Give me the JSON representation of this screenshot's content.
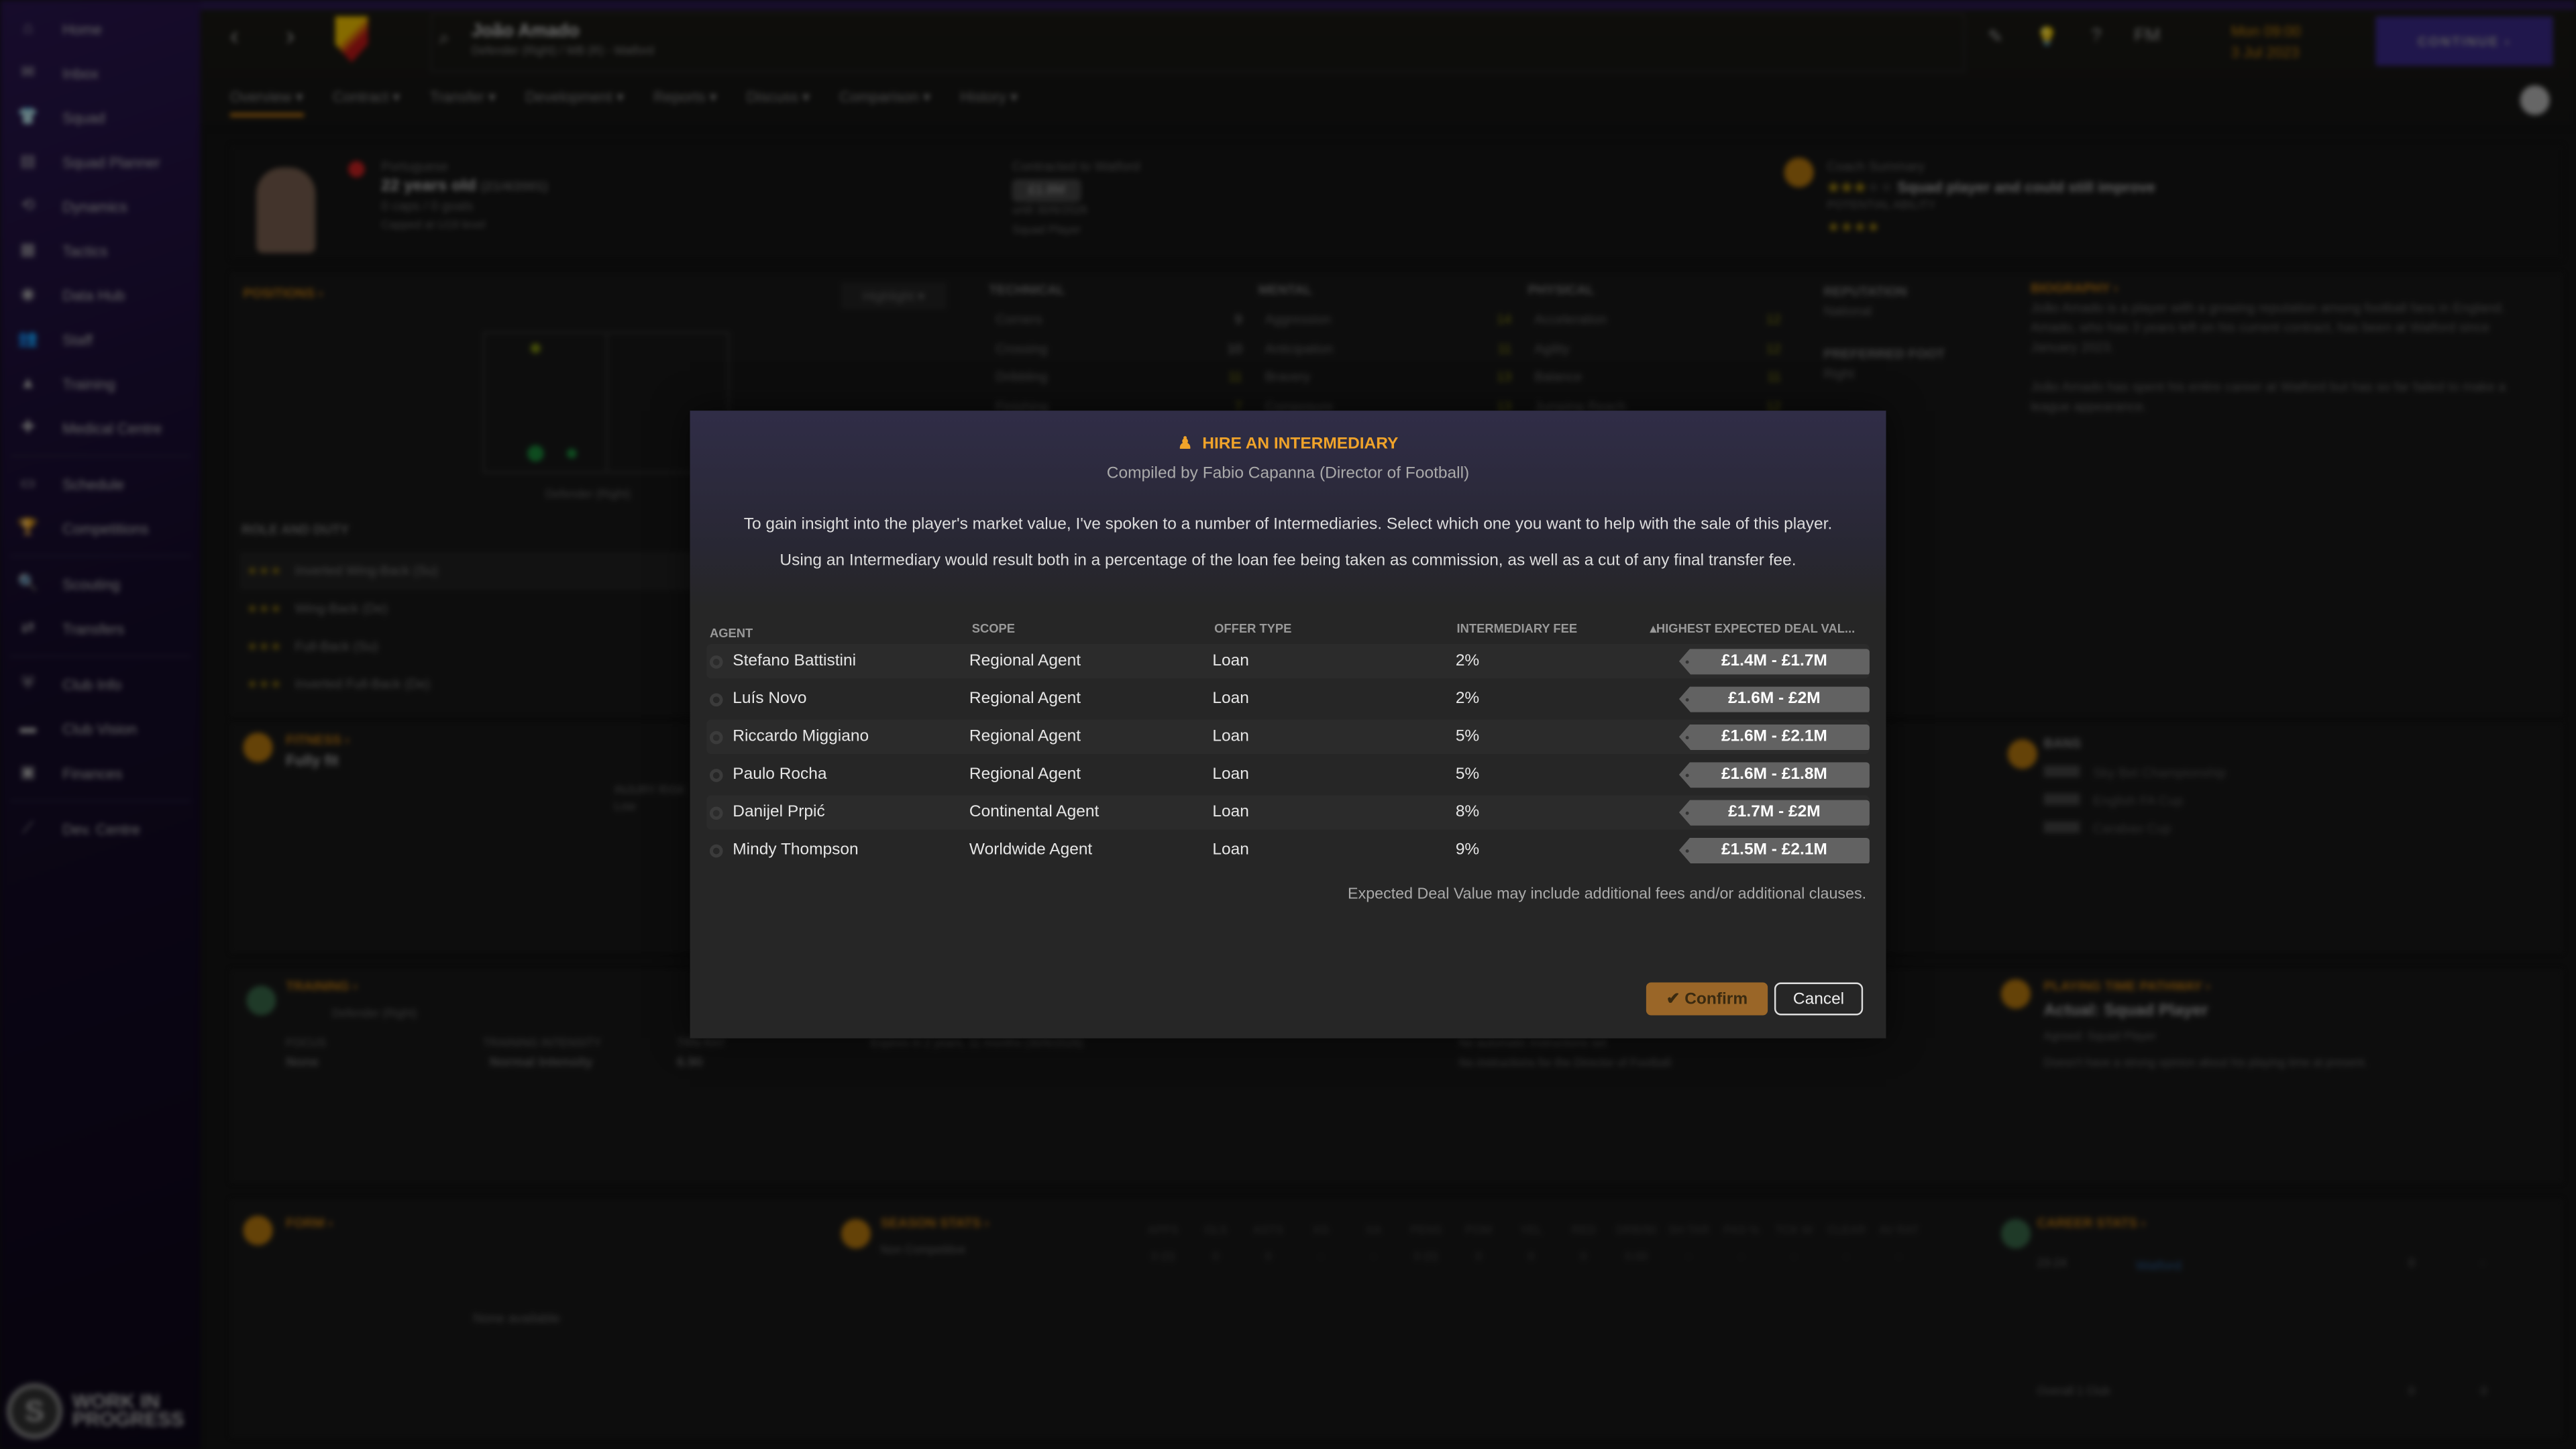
{
  "sidebar": {
    "items": [
      {
        "label": "Home",
        "icon": "home-icon",
        "glyph": "⌂"
      },
      {
        "label": "Inbox",
        "icon": "inbox-icon",
        "glyph": "✉"
      },
      {
        "label": "Squad",
        "icon": "shirt-icon",
        "glyph": "👕"
      },
      {
        "label": "Squad Planner",
        "icon": "clipboard-icon",
        "glyph": "▤"
      },
      {
        "label": "Dynamics",
        "icon": "dynamics-icon",
        "glyph": "⟲"
      },
      {
        "label": "Tactics",
        "icon": "tactics-icon",
        "glyph": "▦"
      },
      {
        "label": "Data Hub",
        "icon": "data-hub-icon",
        "glyph": "◉"
      },
      {
        "label": "Staff",
        "icon": "staff-icon",
        "glyph": "👥"
      },
      {
        "label": "Training",
        "icon": "training-icon",
        "glyph": "▲"
      },
      {
        "label": "Medical Centre",
        "icon": "medical-icon",
        "glyph": "✚"
      },
      {
        "label": "Schedule",
        "icon": "calendar-icon",
        "glyph": "▭"
      },
      {
        "label": "Competitions",
        "icon": "trophy-icon",
        "glyph": "🏆"
      },
      {
        "label": "Scouting",
        "icon": "search-icon",
        "glyph": "🔍"
      },
      {
        "label": "Transfers",
        "icon": "transfers-icon",
        "glyph": "⇄"
      },
      {
        "label": "Club Info",
        "icon": "shield-icon",
        "glyph": "⛨"
      },
      {
        "label": "Club Vision",
        "icon": "vision-icon",
        "glyph": "▬"
      },
      {
        "label": "Finances",
        "icon": "finances-icon",
        "glyph": "▣"
      },
      {
        "label": "Dev. Centre",
        "icon": "dev-centre-icon",
        "glyph": "⟋"
      }
    ],
    "wip_line1": "WORK IN",
    "wip_line2": "PROGRESS",
    "wip_logo": "S"
  },
  "header": {
    "back": "‹",
    "forward": "›",
    "player_name": "João Amado",
    "player_subtitle": "Defender (Right) / WB (R) - Watford",
    "icons": [
      "✎",
      "💡",
      "?",
      "FM"
    ],
    "date_line1": "Mon 09:00",
    "date_line2": "3 Jul 2023",
    "continue_label": "CONTINUE ›",
    "tabs": [
      "Overview ▾",
      "Contract ▾",
      "Transfer ▾",
      "Development ▾",
      "Reports ▾",
      "Discuss ▾",
      "Comparison ▾",
      "History ▾"
    ]
  },
  "profile": {
    "nationality": "Portuguese",
    "age": "22 years old",
    "dob": "(21/4/2001)",
    "caps": "0 caps / 0 goals",
    "capped": "Capped at U19 level",
    "contract_title": "Contracted to Watford",
    "contract_value": "£1.8M",
    "contract_until": "until 30/6/2026",
    "contract_status": "Squad Player",
    "coach_summary_title": "Coach Summary",
    "coach_summary": "Squad player and could still improve",
    "potential_label": "POTENTIAL ABILITY",
    "positions_title": "POSITIONS ›",
    "highlight_label": "Highlight",
    "position_label": "Defender (Right)",
    "role_title": "ROLE AND DUTY",
    "roles": [
      "Inverted Wing-Back (Su)",
      "Wing-Back (De)",
      "Full-Back (Su)",
      "Inverted Full-Back (De)"
    ],
    "attributes": {
      "technical_title": "TECHNICAL",
      "mental_title": "MENTAL",
      "physical_title": "PHYSICAL",
      "technical": [
        [
          "Corners",
          "9"
        ],
        [
          "Crossing",
          "10"
        ],
        [
          "Dribbling",
          "11"
        ],
        [
          "Finishing",
          "7"
        ]
      ],
      "mental": [
        [
          "Aggression",
          "14"
        ],
        [
          "Anticipation",
          "11"
        ],
        [
          "Bravery",
          "13"
        ],
        [
          "Composure",
          "13"
        ]
      ],
      "physical": [
        [
          "Acceleration",
          "12"
        ],
        [
          "Agility",
          "12"
        ],
        [
          "Balance",
          "11"
        ],
        [
          "Jumping Reach",
          "12"
        ]
      ]
    },
    "reputation_title": "REPUTATION",
    "reputation": "National",
    "foot_title": "PREFERRED FOOT",
    "foot": "Right",
    "biography_title": "BIOGRAPHY ›",
    "bio1": "João Amado is a player with a growing reputation among football fans in England. Amado, who has 3 years left on his current contract, has been at Watford since January 2023.",
    "bio2": "João Amado has spent his entire career at Watford but has so far failed to make a league appearance.",
    "fitness_title": "FITNESS ›",
    "fitness": "Fully fit",
    "injury_label": "INJURY RISK",
    "injury": "Low",
    "bans_title": "BANS",
    "bans": [
      "Sky Bet Championship",
      "English FA Cup",
      "Carabao Cup"
    ],
    "training_title": "TRAINING ›",
    "training_pos": "Defender (Right)",
    "focus_label": "FOCUS",
    "focus": "None",
    "intensity_label": "TRAINING INTENSITY",
    "intensity": "Normal Intensity",
    "trn_label": "TRN RAT",
    "trn": "6.90",
    "contract_expiry": "Expires in 2 years, 11 months (30/6/2026)",
    "instructions1": "No automatic instructions set",
    "instructions2": "No instructions for the Director of Football",
    "ptp_title": "PLAYING TIME PATHWAY ›",
    "ptp_actual": "Actual: Squad Player",
    "ptp_agreed": "Agreed: Squad Player",
    "ptp_note": "Doesn't have a strong opinion about his playing time at present.",
    "form_title": "FORM ›",
    "form_none": "None available",
    "season_title": "SEASON STATS ›",
    "season_row": "Non Competitive",
    "season_cols": [
      "APPS",
      "GLS",
      "ASTS",
      "XG",
      "XA",
      "PENS",
      "POM",
      "YEL",
      "RED",
      "DRB/90",
      "SH TAR",
      "PAS %",
      "TCK W",
      "CLEAR",
      "AV RAT"
    ],
    "season_vals": [
      "0 (0)",
      "0",
      "0",
      "-",
      "-",
      "0 (0)",
      "0",
      "0",
      "0",
      "0.00",
      "-",
      "-",
      "-",
      "-",
      "-"
    ],
    "career_title": "CAREER STATS ›",
    "career_year": "23-24",
    "career_team": "Watford",
    "career_apps": "0",
    "career_goals": "-",
    "career_overall": "Overall  1 Club",
    "career_overall_apps": "0",
    "career_overall_goals": "0"
  },
  "dialog": {
    "title": "HIRE AN INTERMEDIARY",
    "title_icon": "person-pin-icon",
    "compiled_by": "Compiled by Fabio Capanna (Director of Football)",
    "paragraph1": "To gain insight into the player's market value, I've spoken to a number of Intermediaries. Select which one you want to help with the sale of this player.",
    "paragraph2": "Using an Intermediary would result both in a percentage of the loan fee being taken as commission, as well as a cut of any final transfer fee.",
    "columns": {
      "agent": "AGENT",
      "scope": "SCOPE",
      "offer_type": "OFFER TYPE",
      "fee": "INTERMEDIARY FEE",
      "value": "▴HIGHEST EXPECTED DEAL VAL..."
    },
    "rows": [
      {
        "agent": "Stefano Battistini",
        "scope": "Regional Agent",
        "offer": "Loan",
        "fee": "2%",
        "value": "£1.4M - £1.7M"
      },
      {
        "agent": "Luís Novo",
        "scope": "Regional Agent",
        "offer": "Loan",
        "fee": "2%",
        "value": "£1.6M - £2M"
      },
      {
        "agent": "Riccardo Miggiano",
        "scope": "Regional Agent",
        "offer": "Loan",
        "fee": "5%",
        "value": "£1.6M - £2.1M"
      },
      {
        "agent": "Paulo Rocha",
        "scope": "Regional Agent",
        "offer": "Loan",
        "fee": "5%",
        "value": "£1.6M - £1.8M"
      },
      {
        "agent": "Danijel Prpić",
        "scope": "Continental Agent",
        "offer": "Loan",
        "fee": "8%",
        "value": "£1.7M - £2M"
      },
      {
        "agent": "Mindy Thompson",
        "scope": "Worldwide Agent",
        "offer": "Loan",
        "fee": "9%",
        "value": "£1.5M - £2.1M"
      }
    ],
    "note": "Expected Deal Value may include additional fees and/or additional clauses.",
    "confirm_label": "✔ Confirm",
    "cancel_label": "Cancel"
  },
  "colors": {
    "accent": "#f0a32a",
    "confirm": "#9a6628",
    "sidebar": "#1a0f33",
    "continue": "#3b2a8a"
  }
}
